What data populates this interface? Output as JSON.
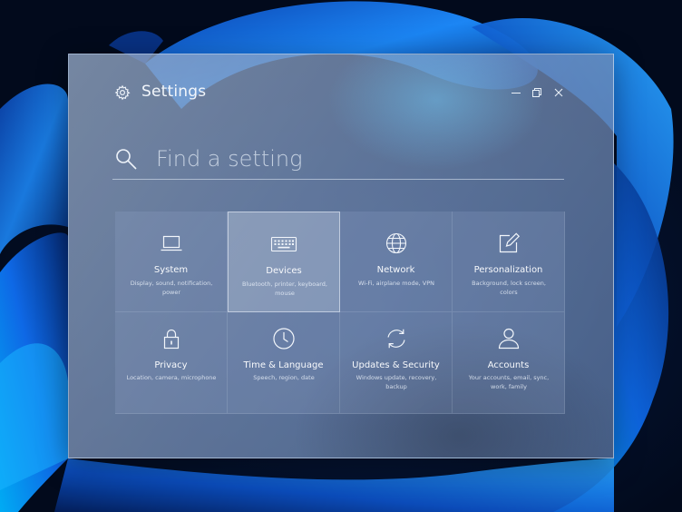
{
  "window": {
    "title": "Settings",
    "title_icon": "gear-icon",
    "controls": [
      {
        "name": "minimize",
        "icon": "minimize-icon"
      },
      {
        "name": "restore",
        "icon": "restore-icon"
      },
      {
        "name": "close",
        "icon": "close-icon"
      }
    ]
  },
  "search": {
    "placeholder": "Find a setting",
    "value": "",
    "icon": "search-icon"
  },
  "categories": [
    {
      "name": "System",
      "description": "Display, sound, notification, power",
      "icon": "laptop-icon"
    },
    {
      "name": "Devices",
      "description": "Bluetooth, printer, keyboard, mouse",
      "icon": "keyboard-icon",
      "selected": true
    },
    {
      "name": "Network",
      "description": "Wi-Fi, airplane mode, VPN",
      "icon": "globe-icon"
    },
    {
      "name": "Personalization",
      "description": "Background, lock screen, colors",
      "icon": "pen-square-icon"
    },
    {
      "name": "Privacy",
      "description": "Location, camera, microphone",
      "icon": "lock-icon"
    },
    {
      "name": "Time & Language",
      "description": "Speech, region, date",
      "icon": "clock-icon"
    },
    {
      "name": "Updates & Security",
      "description": "Windows update, recovery, backup",
      "icon": "sync-icon"
    },
    {
      "name": "Accounts",
      "description": "Your accounts, email, sync, work, family",
      "icon": "person-icon"
    }
  ],
  "colors": {
    "wallpaper_bg": "#04122f",
    "bloom_light": "#2f9bff",
    "bloom_dark": "#0a3fa8",
    "text": "#f2f6fb"
  }
}
